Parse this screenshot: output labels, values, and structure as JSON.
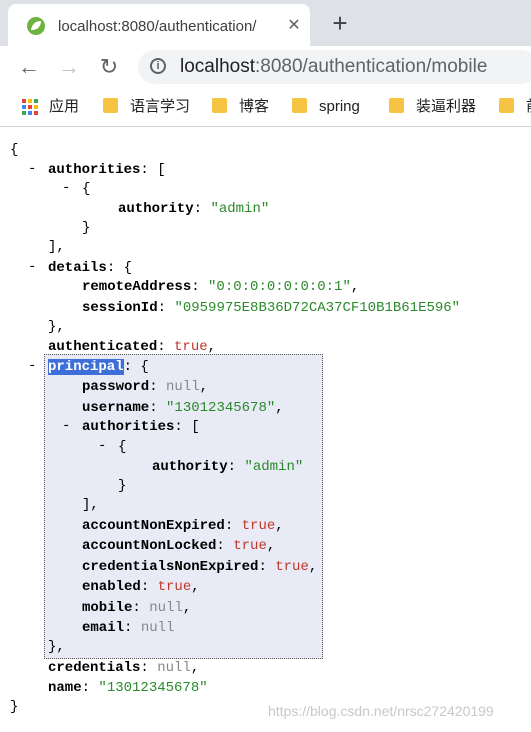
{
  "tab": {
    "title": "localhost:8080/authentication/",
    "close_glyph": "✕",
    "new_tab_glyph": "+"
  },
  "toolbar": {
    "url_host": "localhost",
    "url_path": ":8080/authentication/mobile",
    "back_glyph": "←",
    "forward_glyph": "→",
    "reload_glyph": "↻",
    "info_glyph": "i"
  },
  "bookmarks": [
    "应用",
    "语言学习",
    "博客",
    "spring",
    "装逼利器",
    "前"
  ],
  "json": {
    "authorities_key": "authorities",
    "authority_key": "authority",
    "authority_value": "\"admin\"",
    "details_key": "details",
    "remote_address_key": "remoteAddress",
    "remote_address_value": "\"0:0:0:0:0:0:0:1\"",
    "session_id_key": "sessionId",
    "session_id_value": "\"0959975E8B36D72CA37CF10B1B61E596\"",
    "authenticated_key": "authenticated",
    "authenticated_value": "true",
    "principal_key": "principal",
    "password_key": "password",
    "password_value": "null",
    "username_key": "username",
    "username_value": "\"13012345678\"",
    "p_authorities_key": "authorities",
    "p_authority_key": "authority",
    "p_authority_value": "\"admin\"",
    "account_non_expired_key": "accountNonExpired",
    "account_non_expired_value": "true",
    "account_non_locked_key": "accountNonLocked",
    "account_non_locked_value": "true",
    "credentials_non_expired_key": "credentialsNonExpired",
    "credentials_non_expired_value": "true",
    "enabled_key": "enabled",
    "enabled_value": "true",
    "mobile_key": "mobile",
    "mobile_value": "null",
    "email_key": "email",
    "email_value": "null",
    "credentials_key": "credentials",
    "credentials_value": "null",
    "name_key": "name",
    "name_value": "\"13012345678\""
  },
  "watermark": "https://blog.csdn.net/nrsc272420199",
  "colors": {
    "string": "#2a8a2a",
    "boolean": "#c0392b",
    "null": "#888888",
    "selection": "#3e6fd8",
    "folder": "#f6c342"
  }
}
